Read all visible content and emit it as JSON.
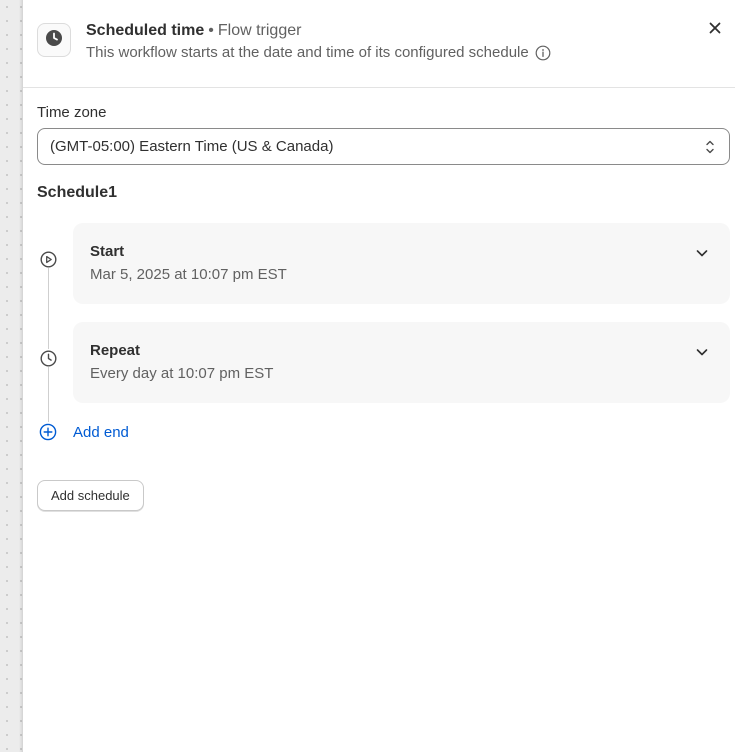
{
  "header": {
    "title": "Scheduled time",
    "separator": "•",
    "subtitle": "Flow trigger",
    "description": "This workflow starts at the date and time of its configured schedule",
    "trigger_icon": "clock-icon",
    "info_icon": "info-icon",
    "close_icon": "close-icon"
  },
  "timezone": {
    "label": "Time zone",
    "value": "(GMT-05:00) Eastern Time (US & Canada)"
  },
  "schedule": {
    "title": "Schedule1",
    "steps": [
      {
        "title": "Start",
        "detail": "Mar 5, 2025 at 10:07 pm EST",
        "icon": "play-circle-icon"
      },
      {
        "title": "Repeat",
        "detail": "Every day at 10:07 pm EST",
        "icon": "clock-icon"
      }
    ],
    "add_end_label": "Add end"
  },
  "add_schedule_label": "Add schedule",
  "colors": {
    "link": "#005bd3",
    "text": "#303030",
    "muted": "#616161",
    "card_bg": "#f7f7f7"
  }
}
